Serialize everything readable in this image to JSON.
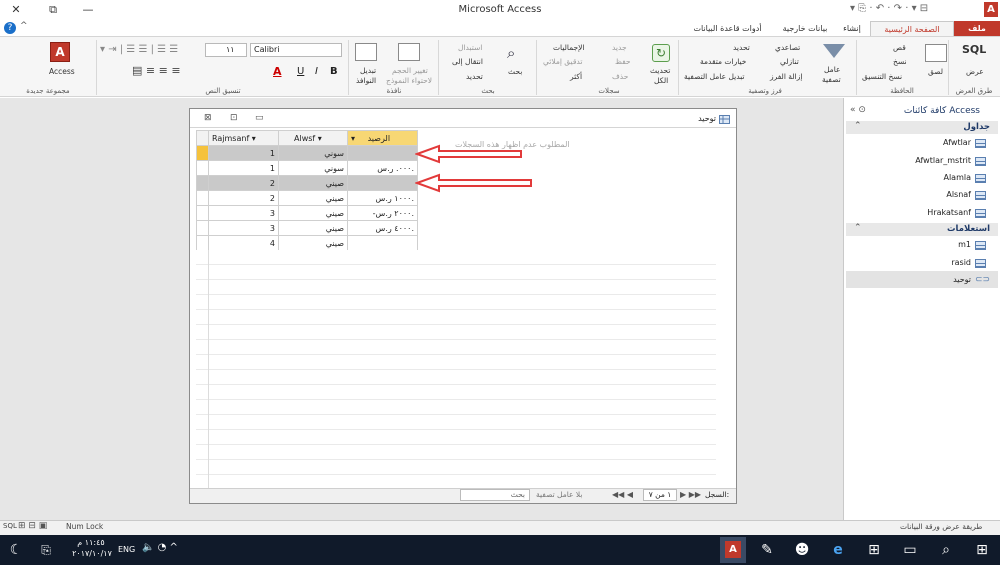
{
  "window": {
    "title": "Microsoft Access"
  },
  "qat": {
    "app_badge": "A"
  },
  "tabs": {
    "file": "ملف",
    "home": "الصفحة الرئيسية",
    "create": "إنشاء",
    "external": "بيانات خارجية",
    "dbtools": "أدوات قاعدة البيانات"
  },
  "ribbon": {
    "views": {
      "sql_label": "SQL",
      "view_label": "عرض",
      "group": "طرق العرض"
    },
    "clipboard": {
      "cut": "قص",
      "copy": "نسخ",
      "paste": "لصق",
      "format_painter": "نسخ التنسيق",
      "group": "الحافظة"
    },
    "sort": {
      "filter": "عامل",
      "filter2": "تصفية",
      "asc": "تصاعدي",
      "desc": "تنازلي",
      "remove_sort": "إزالة الفرز",
      "selection": "تحديد",
      "advanced": "خيارات متقدمة",
      "toggle_filter": "تبديل عامل التصفية",
      "group": "فرز وتصفية"
    },
    "records": {
      "refresh": "تحديث",
      "refresh2": "الكل",
      "new": "جديد",
      "save": "حفظ",
      "delete": "حذف",
      "totals": "الإجماليات",
      "spelling": "تدقيق إملائي",
      "more": "أكثر",
      "group": "سجلات"
    },
    "find": {
      "find": "بحث",
      "replace": "استبدال",
      "goto": "انتقال إلى",
      "select": "تحديد",
      "group": "بحث"
    },
    "window": {
      "size": "تغيير الحجم",
      "size2": "لاحتواء النموذج",
      "switch": "تبديل",
      "switch2": "النوافذ",
      "group": "نافذة"
    },
    "text": {
      "font": "Calibri",
      "size": "١١",
      "bold": "B",
      "italic": "I",
      "underline": "U",
      "group": "تنسيق النص"
    },
    "addins": {
      "access": "Access",
      "group": "مجموعة جديدة"
    }
  },
  "datasheet": {
    "title": "توحيد",
    "headers": {
      "raseed": "الرصيد",
      "alwsf": "Alwsf",
      "rajmsanf": "Rajmsanf"
    },
    "rows": [
      {
        "raseed": "",
        "alwsf": "سوني",
        "rajmsanf": "1"
      },
      {
        "raseed": "٠٠٠. ر.س.",
        "alwsf": "سوني",
        "rajmsanf": "1"
      },
      {
        "raseed": "",
        "alwsf": "صيني",
        "rajmsanf": "2"
      },
      {
        "raseed": "١٠٠٠ ر.س.",
        "alwsf": "صيني",
        "rajmsanf": "2"
      },
      {
        "raseed": "-٢٠٠٠ ر.س.",
        "alwsf": "صيني",
        "rajmsanf": "3"
      },
      {
        "raseed": "٤٠٠٠ ر.س.",
        "alwsf": "صيني",
        "rajmsanf": "3"
      },
      {
        "raseed": "",
        "alwsf": "صيني",
        "rajmsanf": "4"
      }
    ],
    "annotation": "المطلوب عدم اظهار هذه السجلات",
    "record_nav": {
      "label": "السجل:",
      "position": "١ من ٧",
      "filter": "بلا عامل تصفية",
      "search": "بحث"
    }
  },
  "nav_pane": {
    "title": "كافة كائنات Access",
    "tables_header": "جداول",
    "tables": [
      "Afwtlar",
      "Afwtlar_mstrit",
      "Alamla",
      "Alsnaf",
      "Hrakatsanf"
    ],
    "queries_header": "استعلامات",
    "queries": [
      "m1",
      "rasid",
      "توحيد"
    ]
  },
  "status": {
    "left": "طريقة عرض ورقة البيانات",
    "numlock": "Num Lock",
    "sql": "SQL"
  },
  "taskbar": {
    "time": "١١:٤٥ م",
    "date": "٢٠١٧/١٠/١٧",
    "lang": "ENG"
  },
  "colors": {
    "accent": "#c0392b",
    "arrow": "#e23a3a",
    "selected_header": "#f7d774"
  }
}
